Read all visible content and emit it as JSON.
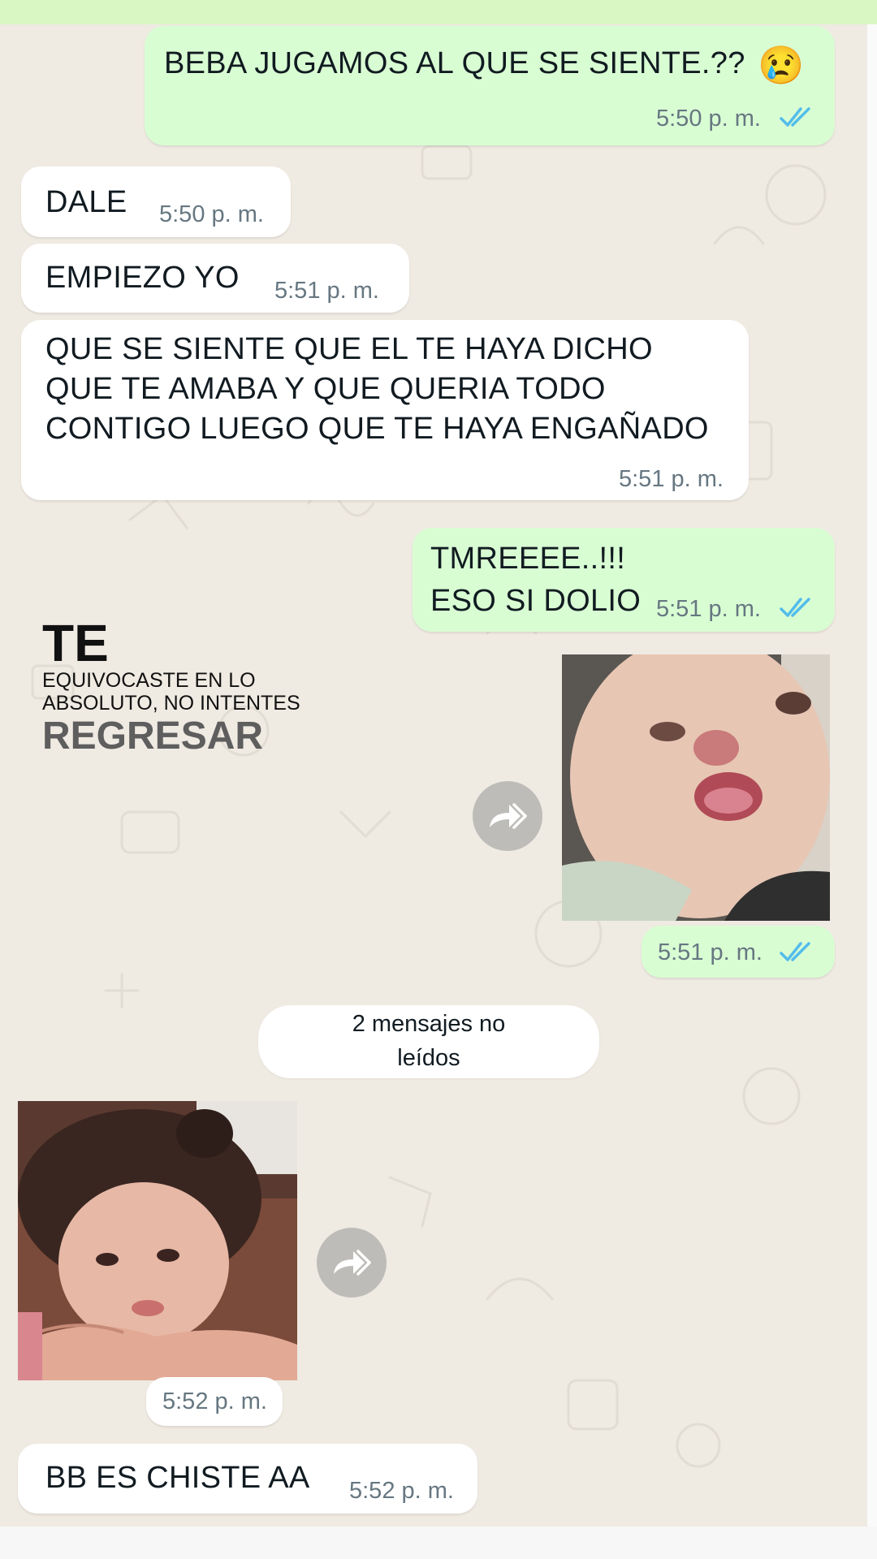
{
  "messages": [
    {
      "text": "BEBA JUGAMOS AL QUE SE SIENTE.??",
      "emoji": "😢",
      "time": "5:50 p. m."
    },
    {
      "text": "DALE",
      "time": "5:50 p. m."
    },
    {
      "text": "EMPIEZO YO",
      "time": "5:51 p. m."
    },
    {
      "text": "QUE SE SIENTE QUE EL TE HAYA  DICHO\nQUE TE AMABA Y QUE QUERIA TODO\nCONTIGO LUEGO QUE  TE HAYA ENGAÑADO",
      "time": "5:51 p. m."
    },
    {
      "text": "TMREEEE..!!!\nESO SI DOLIO",
      "time": "5:51 p. m."
    },
    {
      "time": "5:51 p. m."
    },
    {
      "time": "5:52 p. m."
    },
    {
      "text": "BB ES CHISTE AA",
      "time": "5:52 p. m."
    }
  ],
  "sticker_caption": {
    "line1": "TE",
    "line2": "EQUIVOCASTE EN LO",
    "line3": "ABSOLUTO, NO INTENTES",
    "line4": "REGRESAR"
  },
  "unread_divider": "2 mensajes no\nleídos",
  "icons": {
    "read_receipt": "double-check-icon",
    "forward": "forward-icon",
    "emoji": "crying-face-emoji"
  },
  "colors": {
    "outgoing_bubble": "#d9fdd3",
    "incoming_bubble": "#ffffff",
    "chat_background": "#efeae2",
    "read_tick": "#53bdeb",
    "timestamp": "#667781"
  }
}
